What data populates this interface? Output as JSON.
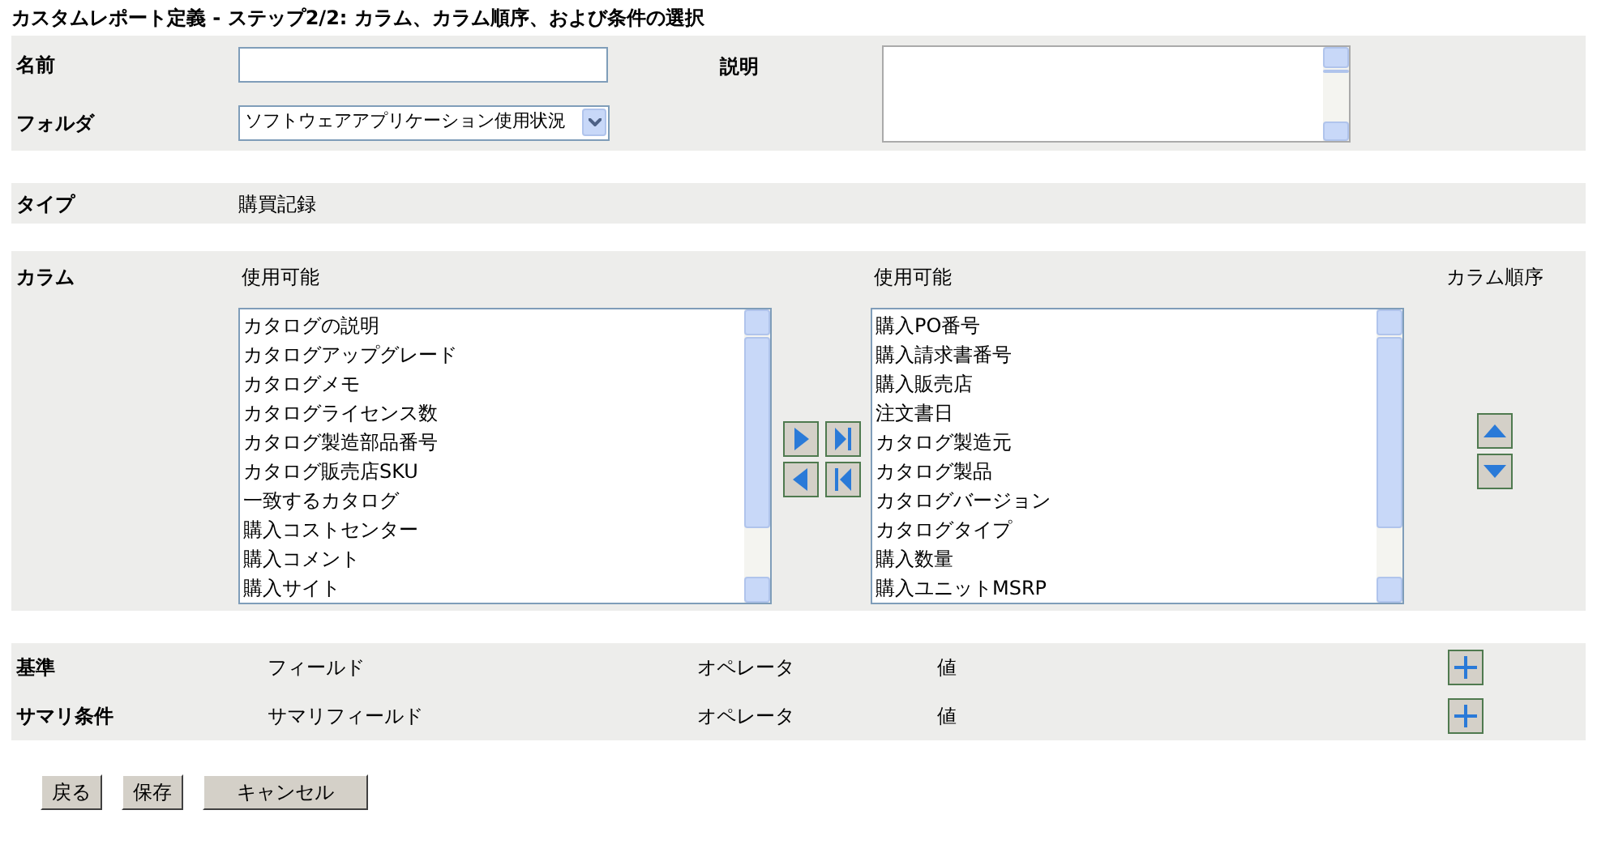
{
  "title": "カスタムレポート定義 - ステップ2/2: カラム、カラム順序、および条件の選択",
  "name_field": {
    "label": "名前"
  },
  "description_field": {
    "label": "説明"
  },
  "folder": {
    "label": "フォルダ",
    "value": "ソフトウェアアプリケーション使用状況"
  },
  "type": {
    "label": "タイプ",
    "value": "購買記録"
  },
  "columns": {
    "label": "カラム",
    "available_label": "使用可能",
    "available": [
      "カタログの説明",
      "カタログアップグレード",
      "カタログメモ",
      "カタログライセンス数",
      "カタログ製造部品番号",
      "カタログ販売店SKU",
      "一致するカタログ",
      "購入コストセンター",
      "購入コメント",
      "購入サイト"
    ],
    "selected_label": "使用可能",
    "selected": [
      "購入PO番号",
      "購入請求書番号",
      "購入販売店",
      "注文書日",
      "カタログ製造元",
      "カタログ製品",
      "カタログバージョン",
      "カタログタイプ",
      "購入数量",
      "購入ユニットMSRP"
    ],
    "order_label": "カラム順序"
  },
  "criteria": [
    {
      "label": "基準",
      "field": "フィールド",
      "operator": "オペレータ",
      "value": "値"
    },
    {
      "label": "サマリ条件",
      "field": "サマリフィールド",
      "operator": "オペレータ",
      "value": "値"
    }
  ],
  "buttons": [
    "戻る",
    "保存",
    "キャンセル"
  ]
}
